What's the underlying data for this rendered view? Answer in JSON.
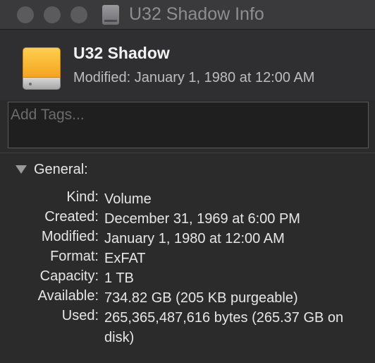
{
  "window": {
    "title": "U32 Shadow Info"
  },
  "header": {
    "name": "U32 Shadow",
    "modified": "Modified: January 1, 1980 at 12:00 AM"
  },
  "tags": {
    "placeholder": "Add Tags..."
  },
  "general": {
    "title": "General:",
    "rows": [
      {
        "label": "Kind:",
        "value": "Volume"
      },
      {
        "label": "Created:",
        "value": "December 31, 1969 at 6:00 PM"
      },
      {
        "label": "Modified:",
        "value": "January 1, 1980 at 12:00 AM"
      },
      {
        "label": "Format:",
        "value": "ExFAT"
      },
      {
        "label": "Capacity:",
        "value": "1 TB"
      },
      {
        "label": "Available:",
        "value": "734.82 GB (205 KB purgeable)"
      },
      {
        "label": "Used:",
        "value": "265,365,487,616 bytes (265.37 GB on disk)"
      }
    ]
  },
  "colors": {
    "window_background": "#2b2b2b",
    "titlebar": "#3a3a3c",
    "drive_accent": "#f5a31e"
  }
}
